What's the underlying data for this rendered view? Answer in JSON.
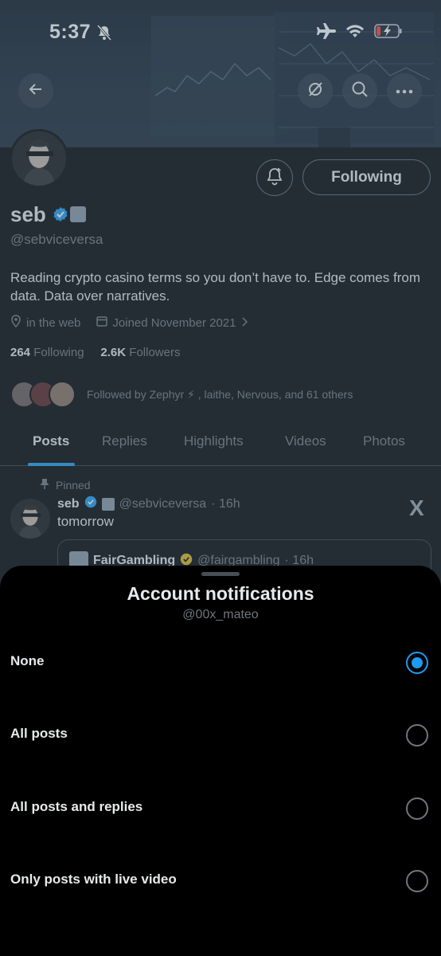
{
  "status_bar": {
    "time": "5:37"
  },
  "profile": {
    "name": "seb",
    "handle": "@sebviceversa",
    "follow_button": "Following",
    "bio": "Reading crypto casino terms so you don’t have to. Edge comes from data. Data over narratives.",
    "location": "in the web",
    "joined": "Joined November 2021",
    "following_count": "264",
    "following_label": "Following",
    "followers_count": "2.6K",
    "followers_label": "Followers",
    "followed_by": "Followed by Zephyr ⚡ , laithe, Nervous, and 61 others"
  },
  "tabs": [
    "Posts",
    "Replies",
    "Highlights",
    "Videos",
    "Photos"
  ],
  "pinned_post": {
    "pinned_label": "Pinned",
    "author_name": "seb",
    "author_handle": "@sebviceversa",
    "time": "· 16h",
    "text": "tomorrow",
    "x_logo": "X",
    "quote_author": "FairGambling",
    "quote_handle": "@fairgambling",
    "quote_time": "· 16h"
  },
  "sheet": {
    "title": "Account notifications",
    "subtitle": "@00x_mateo",
    "options": [
      {
        "label": "None",
        "selected": true
      },
      {
        "label": "All posts",
        "selected": false
      },
      {
        "label": "All posts and replies",
        "selected": false
      },
      {
        "label": "Only posts with live video",
        "selected": false
      }
    ]
  },
  "colors": {
    "accent": "#1d9bf0",
    "muted": "#71767b",
    "text": "#e7e9ea",
    "background": "#000000"
  }
}
